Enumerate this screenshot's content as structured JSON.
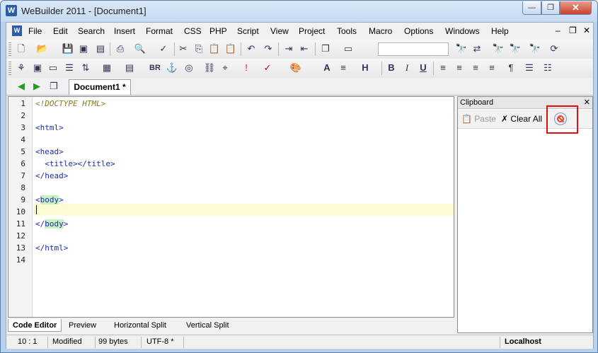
{
  "window": {
    "title": "WeBuilder 2011 - [Document1]",
    "app_icon": "W",
    "min": "—",
    "max": "❐",
    "close": "✕"
  },
  "menu": {
    "items": [
      "File",
      "Edit",
      "Search",
      "Insert",
      "Format",
      "CSS",
      "PHP",
      "Script",
      "View",
      "Project",
      "Tools",
      "Macro",
      "Options",
      "Windows",
      "Help"
    ],
    "mdi_min": "–",
    "mdi_restore": "❐",
    "mdi_close": "✕"
  },
  "toolbar2": {
    "br_label": "BR",
    "h_label": "H",
    "bold": "B",
    "italic": "I",
    "underline": "U",
    "pilcrow": "¶"
  },
  "doc_tab": {
    "label": "Document1 *"
  },
  "editor": {
    "line_numbers": [
      "1",
      "2",
      "3",
      "4",
      "5",
      "6",
      "7",
      "8",
      "9",
      "10",
      "11",
      "12",
      "13",
      "14"
    ],
    "lines": {
      "l1": "<!DOCTYPE HTML>",
      "l3": "<html>",
      "l5": "<head>",
      "l6": "  <title></title>",
      "l7": "</head>",
      "l9_open": "<",
      "l9_body": "body",
      "l9_close": ">",
      "l11_open": "</",
      "l11_body": "body",
      "l11_close": ">",
      "l13": "</html>"
    }
  },
  "bottom_tabs": [
    "Code Editor",
    "Preview",
    "Horizontal Split",
    "Vertical Split"
  ],
  "clipboard": {
    "title": "Clipboard",
    "close": "✕",
    "paste_label": "Paste",
    "clear_all_label": "Clear All"
  },
  "status": {
    "position": "10 : 1",
    "state": "Modified",
    "size": "99 bytes",
    "encoding": "UTF-8 *",
    "server": "Localhost"
  },
  "colors": {
    "highlight_box": "#e01010",
    "current_line": "#fcfbd4",
    "body_tag_bg": "#c8f2c0"
  }
}
